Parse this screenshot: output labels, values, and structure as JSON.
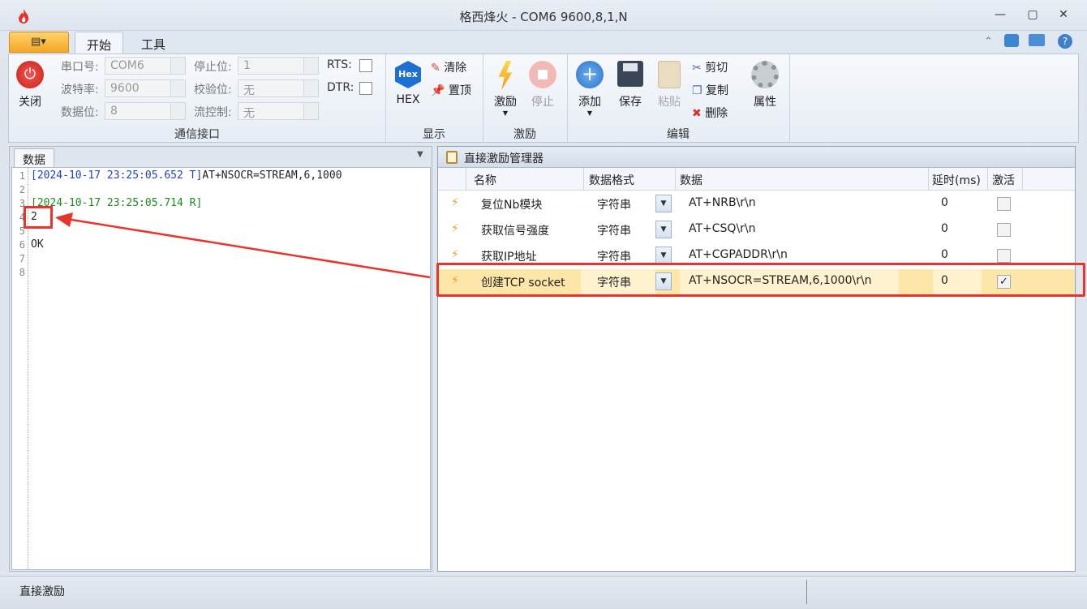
{
  "window": {
    "title": "格西烽火 - COM6  9600,8,1,N"
  },
  "ribbon_tabs": {
    "start": "开始",
    "tools": "工具"
  },
  "comm": {
    "close_label": "关闭",
    "port_label": "串口号:",
    "port_value": "COM6",
    "baud_label": "波特率:",
    "baud_value": "9600",
    "databits_label": "数据位:",
    "databits_value": "8",
    "stopbits_label": "停止位:",
    "stopbits_value": "1",
    "parity_label": "校验位:",
    "parity_value": "无",
    "flow_label": "流控制:",
    "flow_value": "无",
    "rts_label": "RTS:",
    "dtr_label": "DTR:",
    "group": "通信接口"
  },
  "display": {
    "hex_icon": "Hex",
    "hex_label": "HEX",
    "clear_label": "清除",
    "top_label": "置顶",
    "group": "显示"
  },
  "stim": {
    "run_label": "激励",
    "stop_label": "停止",
    "group": "激励"
  },
  "edit": {
    "add_label": "添加",
    "save_label": "保存",
    "paste_label": "粘贴",
    "cut_label": "剪切",
    "copy_label": "复制",
    "delete_label": "删除",
    "props_label": "属性",
    "group": "编辑"
  },
  "left": {
    "tab": "数据",
    "line_numbers": [
      "1",
      "2",
      "3",
      "4",
      "5",
      "6",
      "7",
      "8"
    ],
    "line1_ts": "[2024-10-17 23:25:05.652 T]",
    "line1_cmd": "AT+NSOCR=STREAM,6,1000",
    "line3": "[2024-10-17 23:25:05.714 R]",
    "line4": "2",
    "line6": "OK"
  },
  "manager": {
    "title": "直接激励管理器",
    "headers": {
      "name": "名称",
      "format": "数据格式",
      "data": "数据",
      "delay": "延时(ms)",
      "active": "激活"
    },
    "rows": [
      {
        "name": "复位Nb模块",
        "format": "字符串",
        "data": "AT+NRB\\r\\n",
        "delay": "0",
        "active": false
      },
      {
        "name": "获取信号强度",
        "format": "字符串",
        "data": "AT+CSQ\\r\\n",
        "delay": "0",
        "active": false
      },
      {
        "name": "获取IP地址",
        "format": "字符串",
        "data": "AT+CGPADDR\\r\\n",
        "delay": "0",
        "active": false
      },
      {
        "name": "创建TCP socket",
        "format": "字符串",
        "data": "AT+NSOCR=STREAM,6,1000\\r\\n",
        "delay": "0",
        "active": true
      }
    ]
  },
  "status": {
    "text": "直接激励"
  },
  "colors": {
    "accent_red": "#e8342c",
    "tx_blue": "#1f3fc7",
    "rx_green": "#1e8a1e",
    "highlight_row": "#fde7a8"
  }
}
